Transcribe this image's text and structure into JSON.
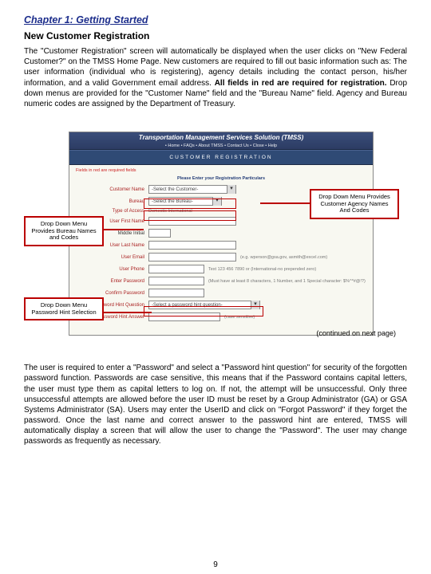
{
  "chapter_title": "Chapter 1: Getting Started",
  "section_title": "New Customer Registration",
  "para1_a": "The \"Customer Registration\" screen will automatically be displayed when the user clicks on \"New Federal Customer?\" on the TMSS Home Page. New customers are required to fill out basic information such as: The user information (individual who is registering), agency details including the contact person, his/her information, and a valid Government email address. ",
  "para1_b": "All fields in red are required for registration.",
  "para1_c": " Drop down menus are provided for the \"Customer Name\" field and the \"Bureau Name\" field. Agency and Bureau numeric codes are assigned by the Department of Treasury.",
  "screenshot": {
    "app_title": "Transportation Management Services Solution (TMSS)",
    "nav_links": "• Home • FAQs • About TMSS • Contact Us • Close • Help",
    "band": "CUSTOMER REGISTRATION",
    "required_note": "Fields in red are required fields",
    "center_note": "Please Enter your Registration Particulars",
    "rows": {
      "customer_name": {
        "label": "Customer Name",
        "value": "-Select the Customer-"
      },
      "bureau": {
        "label": "Bureau",
        "value": "-Select the Bureau-"
      },
      "access_type": {
        "label": "Type of Access",
        "hint": "Domestic  International"
      },
      "first_name": {
        "label": "User First Name"
      },
      "middle": {
        "label": "Middle Initial"
      },
      "last_name": {
        "label": "User Last Name"
      },
      "email": {
        "label": "User Email",
        "hint": "(e.g. wperson@gsa.gov, asmith@excel.com)"
      },
      "phone": {
        "label": "User Phone",
        "hint": "Text 123 456 7890 or (International-no prepended zero)"
      },
      "password": {
        "label": "Enter Password",
        "hint": "(Must have at least 8 characters, 1 Number, and 1 Special character: $%^*#@!?)"
      },
      "confirm": {
        "label": "Confirm Password"
      },
      "hint_q": {
        "label": "Password Hint Question",
        "value": "-Select a password hint question-"
      },
      "hint_a": {
        "label": "Password Hint Answer",
        "hint": "(case sensitive)"
      }
    }
  },
  "callouts": {
    "agency": "Drop Down Menu Provides Customer Agency Names And Codes",
    "bureau": "Drop Down Menu Provides Bureau Names and Codes",
    "hint": "Drop Down Menu Password Hint Selection"
  },
  "continued": "(continued on next page)",
  "para2": "The user is required to enter a \"Password\" and select a \"Password hint question\" for security of the forgotten password function. Passwords are case sensitive, this means that if the Password contains capital letters, the user must type them as capital letters to log on. If not, the attempt will be unsuccessful. Only three unsuccessful attempts are allowed before the user ID must be reset by a Group Administrator (GA) or GSA Systems Administrator (SA). Users may enter the UserID and click on \"Forgot Password\" if they forget the password. Once the last name and correct answer to the password hint are entered, TMSS will automatically display a screen that will allow the user to change the \"Password\". The user may change passwords as frequently as necessary.",
  "page_number": "9"
}
